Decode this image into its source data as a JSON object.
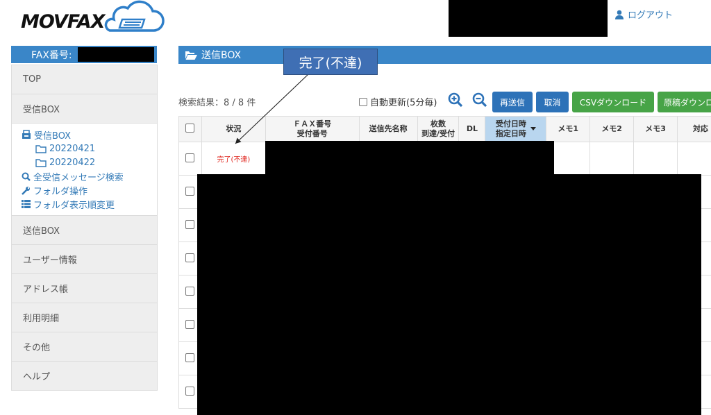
{
  "header": {
    "logo_text": "MOVFAX",
    "logout_label": "ログアウト"
  },
  "sidebar": {
    "fax_number_label": "FAX番号:",
    "items_top": [
      {
        "label": "TOP"
      },
      {
        "label": "受信BOX"
      }
    ],
    "tree": {
      "root": "受信BOX",
      "folders": [
        "20220421",
        "20220422"
      ],
      "search_all": "全受信メッセージ検索",
      "folder_ops": "フォルダ操作",
      "folder_order": "フォルダ表示順変更"
    },
    "items_bottom": [
      {
        "label": "送信BOX"
      },
      {
        "label": "ユーザー情報"
      },
      {
        "label": "アドレス帳"
      },
      {
        "label": "利用明細"
      },
      {
        "label": "その他"
      },
      {
        "label": "ヘルプ"
      }
    ]
  },
  "main": {
    "title": "送信BOX",
    "callout": "完了(不達)",
    "search_result": "検索結果：8 / 8 件",
    "auto_refresh_label": "自動更新(5分毎)",
    "buttons": {
      "resend": "再送信",
      "cancel": "取消",
      "csv": "CSVダウンロード",
      "original": "原稿ダウンロード"
    },
    "table": {
      "headers": {
        "status": "状況",
        "fax_line1": "ＦＡＸ番号",
        "fax_line2": "受付番号",
        "recipient": "送信先名称",
        "pages_line1": "枚数",
        "pages_line2": "到達/受付",
        "dl": "DL",
        "time_line1": "受付日時",
        "time_line2": "指定日時",
        "memo1": "メモ1",
        "memo2": "メモ2",
        "memo3": "メモ3",
        "response": "対応"
      },
      "rows": [
        {
          "status": "完了(不達)"
        },
        {
          "status": ""
        },
        {
          "status": ""
        },
        {
          "status": ""
        },
        {
          "status": ""
        },
        {
          "status": ""
        },
        {
          "status": ""
        },
        {
          "status": ""
        }
      ]
    }
  },
  "colors": {
    "primary_blue": "#3a86c8",
    "button_blue": "#2d72b8",
    "button_green": "#47a447",
    "status_red": "#e0271f"
  }
}
